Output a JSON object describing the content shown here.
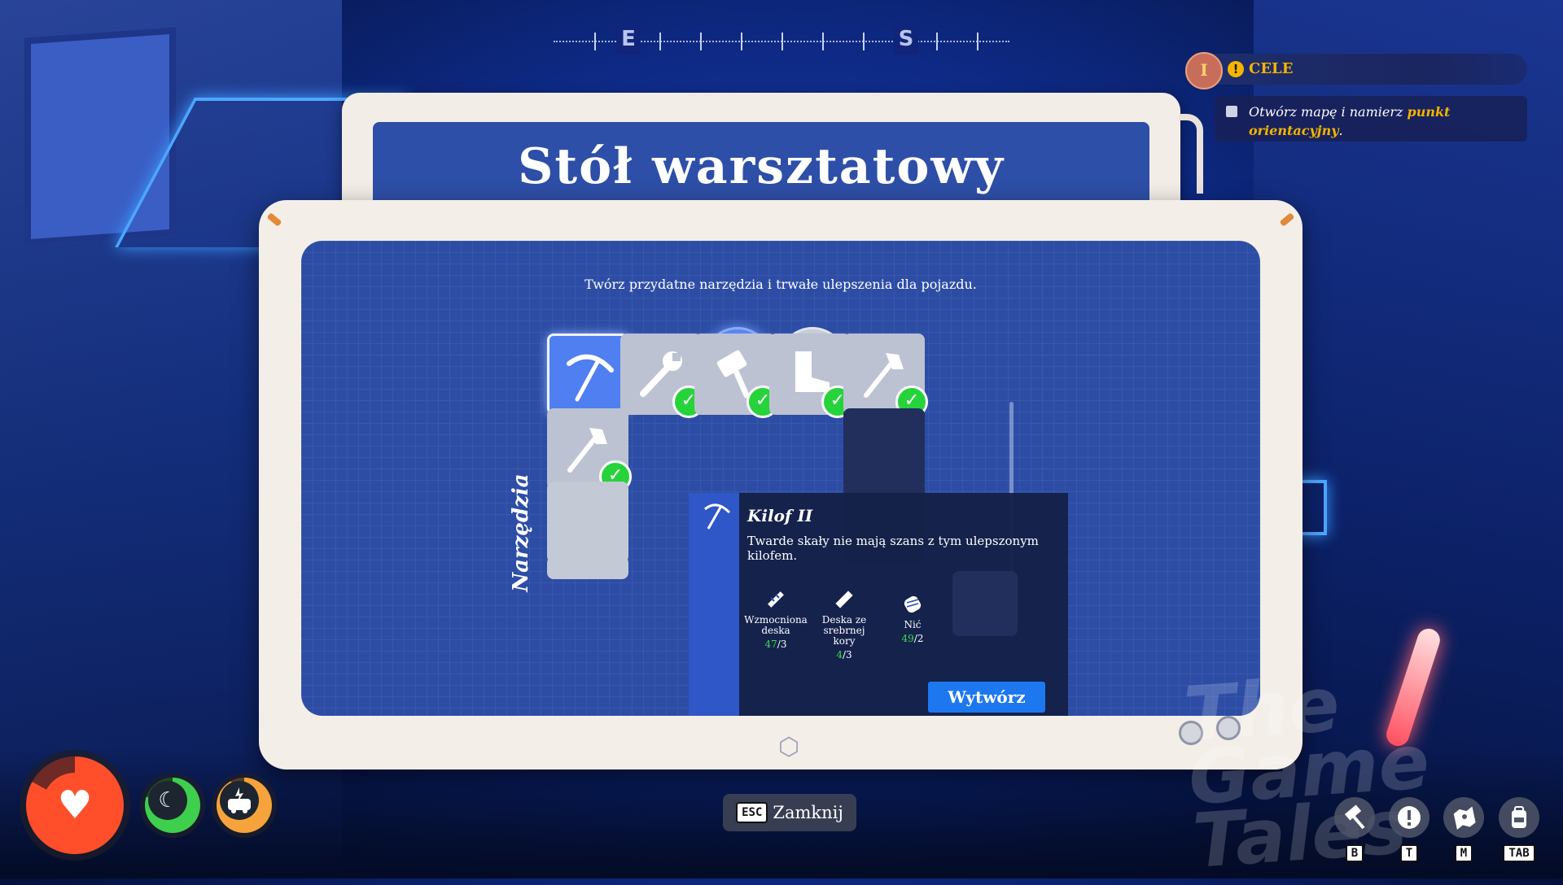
{
  "compass": {
    "markers": [
      "E",
      "S"
    ]
  },
  "objectives": {
    "badge": "I",
    "alert": "!",
    "title": "CELE",
    "task_prefix": "Otwórz mapę i namierz ",
    "task_highlight": "punkt orientacyjny",
    "task_suffix": "."
  },
  "workbench": {
    "title": "Stół warsztatowy",
    "subtitle": "Twórz przydatne narzędzia i trwałe ulepszenia dla pojazdu.",
    "categories": [
      {
        "icon": "axe-icon",
        "selected": true
      },
      {
        "icon": "van-icon",
        "selected": false
      }
    ],
    "category_label": "Narzędzia",
    "items": [
      {
        "icon": "pickaxe-icon",
        "selected": true,
        "crafted": false
      },
      {
        "icon": "wrench-icon",
        "selected": false,
        "crafted": true
      },
      {
        "icon": "hammer-icon",
        "selected": false,
        "crafted": true
      },
      {
        "icon": "boot-icon",
        "selected": false,
        "crafted": true
      },
      {
        "icon": "axe-icon",
        "selected": false,
        "crafted": true
      },
      {
        "icon": "axe-icon",
        "selected": false,
        "crafted": true
      }
    ],
    "tooltip": {
      "name": "Kilof II",
      "description": "Twarde skały nie mają szans z tym ulepszonym kilofem.",
      "ingredients": [
        {
          "name": "Wzmocniona deska",
          "have": "47",
          "need": "3",
          "icon": "reinforced-plank-icon"
        },
        {
          "name": "Deska ze srebrnej kory",
          "have": "4",
          "need": "3",
          "icon": "silverbark-plank-icon"
        },
        {
          "name": "Nić",
          "have": "49",
          "need": "2",
          "icon": "thread-icon"
        }
      ],
      "craft_label": "Wytwórz"
    },
    "close": {
      "key": "ESC",
      "label": "Zamknij"
    }
  },
  "status": {
    "health_level": 0.83,
    "sleep_level": 0.8,
    "energy_level": 0.92,
    "colors": {
      "health": "#ff4f2a",
      "sleep": "#3ecf4d",
      "energy": "#f5a33a"
    }
  },
  "hotkeys": [
    {
      "icon": "hammer-icon",
      "key": "B"
    },
    {
      "icon": "exclamation-icon",
      "key": "T"
    },
    {
      "icon": "map-icon",
      "key": "M"
    },
    {
      "icon": "backpack-icon",
      "key": "TAB"
    }
  ],
  "colors": {
    "accent": "#1d78f0",
    "objective": "#f6b400",
    "check": "#27d33a"
  }
}
